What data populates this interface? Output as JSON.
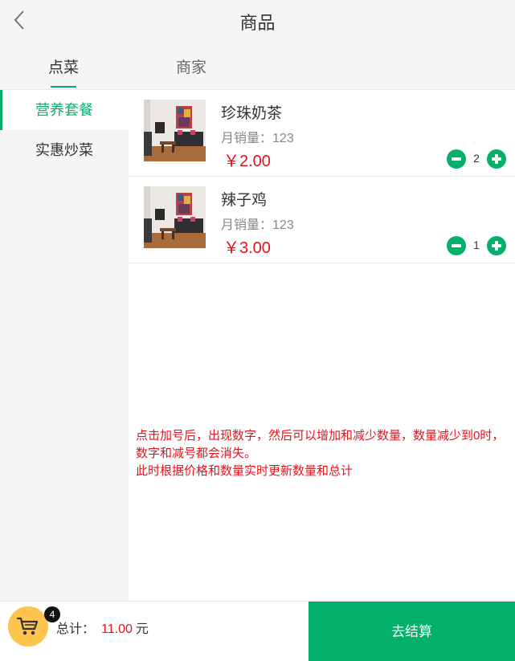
{
  "header": {
    "title": "商品",
    "back_icon": "chevron-left-icon"
  },
  "tabs": [
    {
      "label": "点菜",
      "active": true
    },
    {
      "label": "商家",
      "active": false
    }
  ],
  "sidebar": {
    "items": [
      {
        "label": "营养套餐",
        "active": true
      },
      {
        "label": "实惠炒菜",
        "active": false
      }
    ]
  },
  "products": [
    {
      "name": "珍珠奶茶",
      "sales_label": "月销量：",
      "sales": "123",
      "price": "￥2.00",
      "quantity": "2",
      "image": "living-room-photo"
    },
    {
      "name": "辣子鸡",
      "sales_label": "月销量：",
      "sales": "123",
      "price": "￥3.00",
      "quantity": "1",
      "image": "living-room-photo"
    }
  ],
  "note": {
    "line1": "点击加号后，出现数字，然后可以增加和减少数量，数量减少到0时，数字和减号都会消失。",
    "line2": "此时根据价格和数量实时更新数量和总计"
  },
  "footer": {
    "cart_icon": "shopping-cart-icon",
    "cart_count": "4",
    "total_label": "总计：",
    "total_amount": "11.00",
    "total_unit": "元",
    "checkout_label": "去结算"
  },
  "colors": {
    "accent": "#05b06b",
    "price": "#e8121c",
    "cart": "#fdc54d"
  }
}
